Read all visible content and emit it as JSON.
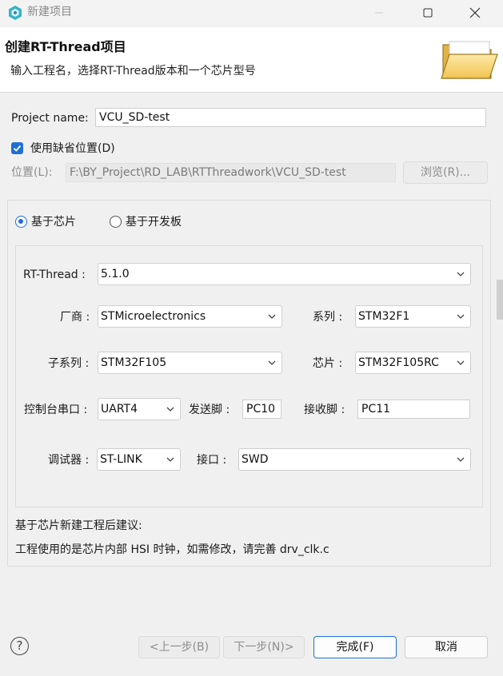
{
  "window": {
    "title": "新建项目"
  },
  "banner": {
    "title": "创建RT-Thread项目",
    "subtitle": "输入工程名，选择RT-Thread版本和一个芯片型号"
  },
  "project": {
    "name_label": "Project name:",
    "name_value": "VCU_SD-test",
    "default_location_label": "使用缺省位置(D)",
    "default_location_checked": true,
    "location_label": "位置(L):",
    "location_value": "F:\\BY_Project\\RD_LAB\\RTThreadwork\\VCU_SD-test",
    "browse_label": "浏览(R)..."
  },
  "mode": {
    "chip_label": "基于芯片",
    "board_label": "基于开发板",
    "selected": "chip"
  },
  "config": {
    "rtthread_label": "RT-Thread :",
    "rtthread_value": "5.1.0",
    "vendor_label": "厂商 :",
    "vendor_value": "STMicroelectronics",
    "series_label": "系列 :",
    "series_value": "STM32F1",
    "subseries_label": "子系列 :",
    "subseries_value": "STM32F105",
    "chip_label": "芯片 :",
    "chip_value": "STM32F105RC",
    "console_label": "控制台串口 :",
    "console_value": "UART4",
    "tx_label": "发送脚 :",
    "tx_value": "PC10",
    "rx_label": "接收脚 :",
    "rx_value": "PC11",
    "debugger_label": "调试器 :",
    "debugger_value": "ST-LINK",
    "interface_label": "接口 :",
    "interface_value": "SWD"
  },
  "advice": {
    "heading": "基于芯片新建工程后建议:",
    "text": "工程使用的是芯片内部 HSI 时钟，如需修改，请完善 drv_clk.c"
  },
  "footer": {
    "help_glyph": "?",
    "back_label": "<上一步(B)",
    "next_label": "下一步(N)>",
    "finish_label": "完成(F)",
    "cancel_label": "取消"
  },
  "colors": {
    "accent": "#1f6fd6",
    "background": "#f0f0f0"
  }
}
